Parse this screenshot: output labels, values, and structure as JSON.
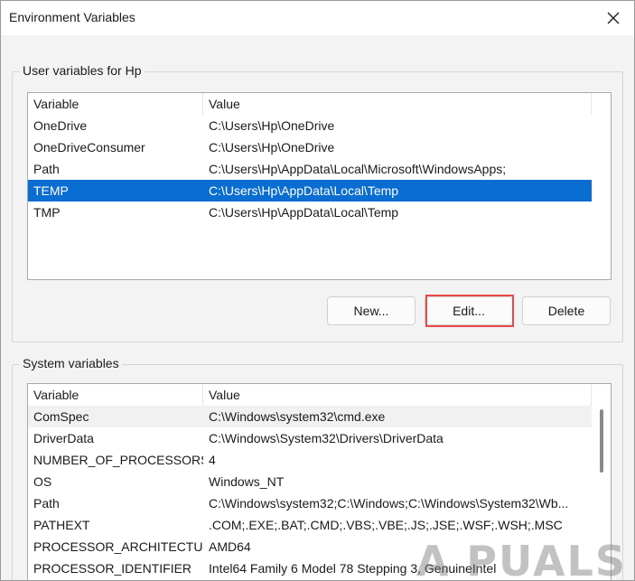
{
  "window": {
    "title": "Environment Variables"
  },
  "user_section": {
    "label": "User variables for Hp",
    "columns": [
      "Variable",
      "Value"
    ],
    "rows": [
      {
        "variable": "OneDrive",
        "value": "C:\\Users\\Hp\\OneDrive"
      },
      {
        "variable": "OneDriveConsumer",
        "value": "C:\\Users\\Hp\\OneDrive"
      },
      {
        "variable": "Path",
        "value": "C:\\Users\\Hp\\AppData\\Local\\Microsoft\\WindowsApps;"
      },
      {
        "variable": "TEMP",
        "value": "C:\\Users\\Hp\\AppData\\Local\\Temp"
      },
      {
        "variable": "TMP",
        "value": "C:\\Users\\Hp\\AppData\\Local\\Temp"
      }
    ],
    "selected_index": 3,
    "buttons": {
      "new": "New...",
      "edit": "Edit...",
      "delete": "Delete"
    }
  },
  "system_section": {
    "label": "System variables",
    "columns": [
      "Variable",
      "Value"
    ],
    "rows": [
      {
        "variable": "ComSpec",
        "value": "C:\\Windows\\system32\\cmd.exe"
      },
      {
        "variable": "DriverData",
        "value": "C:\\Windows\\System32\\Drivers\\DriverData"
      },
      {
        "variable": "NUMBER_OF_PROCESSORS",
        "value": "4"
      },
      {
        "variable": "OS",
        "value": "Windows_NT"
      },
      {
        "variable": "Path",
        "value": "C:\\Windows\\system32;C:\\Windows;C:\\Windows\\System32\\Wb..."
      },
      {
        "variable": "PATHEXT",
        "value": ".COM;.EXE;.BAT;.CMD;.VBS;.VBE;.JS;.JSE;.WSF;.WSH;.MSC"
      },
      {
        "variable": "PROCESSOR_ARCHITECTU...",
        "value": "AMD64"
      },
      {
        "variable": "PROCESSOR_IDENTIFIER",
        "value": "Intel64 Family 6 Model 78 Stepping 3, GenuineIntel"
      }
    ],
    "hover_index": 0
  },
  "watermark": "A PUALS",
  "colors": {
    "selection": "#0a6dd1",
    "highlight": "#e84a4a"
  },
  "icons": {
    "close": "close-icon"
  }
}
